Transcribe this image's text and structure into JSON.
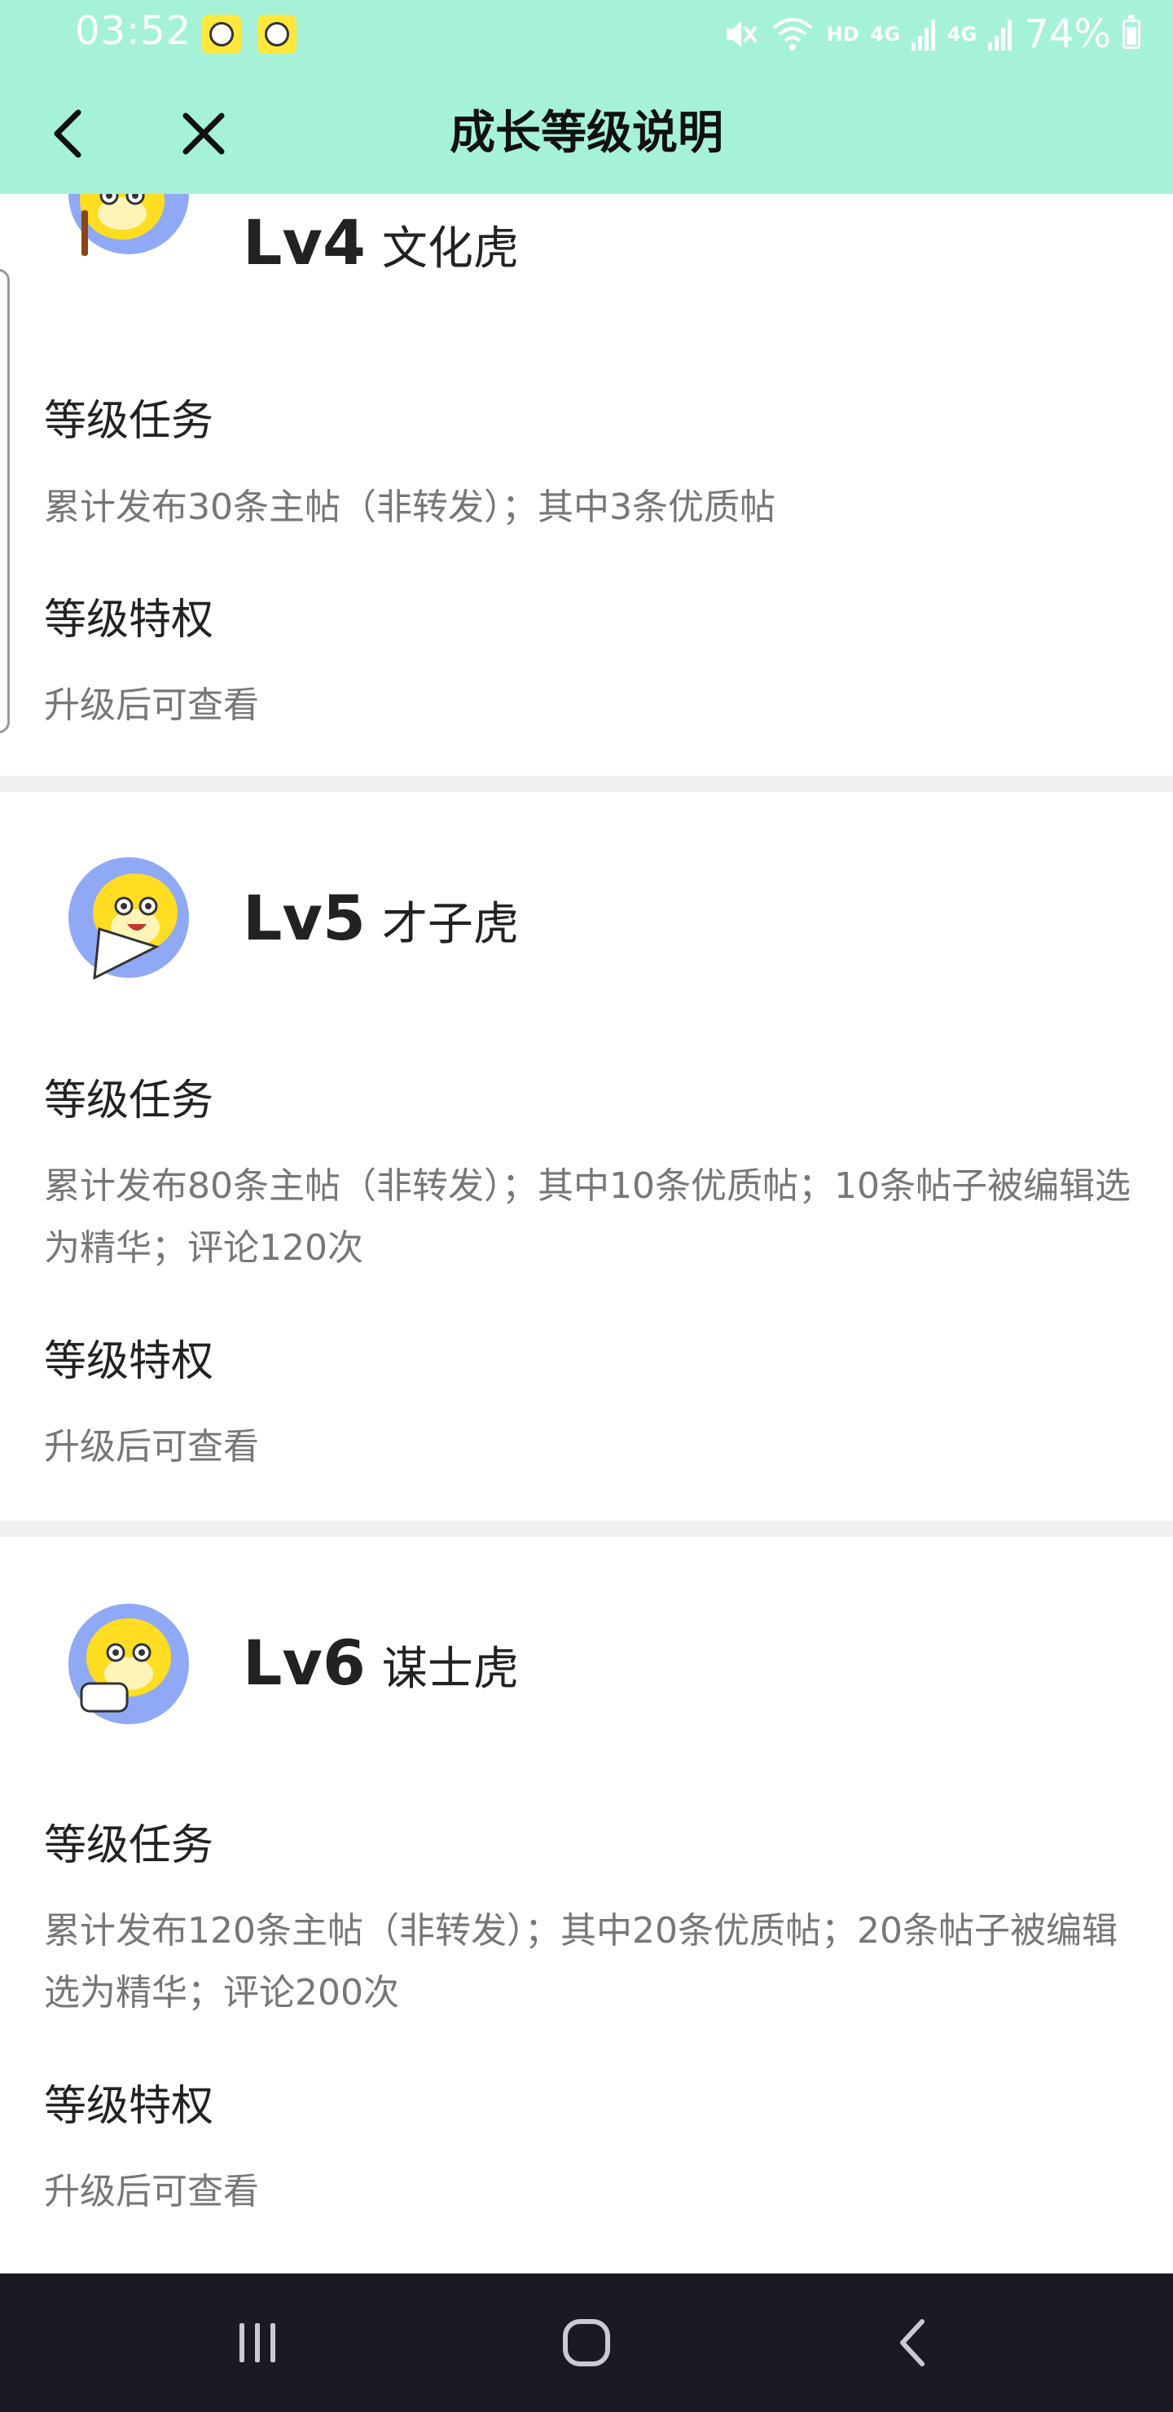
{
  "status_bar": {
    "time": "03:52",
    "network_hd": "HD",
    "network_4g_a": "4G",
    "network_4g_b": "4G",
    "battery": "74%",
    "battery_level": 0.74
  },
  "header": {
    "title": "成长等级说明"
  },
  "levels": [
    {
      "code": "Lv4",
      "name": "文化虎",
      "task_title": "等级任务",
      "task_text": "累计发布30条主帖（非转发）；其中3条优质帖",
      "privilege_title": "等级特权",
      "privilege_text": "升级后可查看"
    },
    {
      "code": "Lv5",
      "name": "才子虎",
      "task_title": "等级任务",
      "task_text": "累计发布80条主帖（非转发）；其中10条优质帖；10条帖子被编辑选为精华；评论120次",
      "privilege_title": "等级特权",
      "privilege_text": "升级后可查看"
    },
    {
      "code": "Lv6",
      "name": "谋士虎",
      "task_title": "等级任务",
      "task_text": "累计发布120条主帖（非转发）；其中20条优质帖；20条帖子被编辑选为精华；评论200次",
      "privilege_title": "等级特权",
      "privilege_text": "升级后可查看"
    }
  ],
  "colors": {
    "header_bg": "#A6F2D9",
    "avatar_bg": "#8FA9F7",
    "tiger_yellow": "#FFDD22",
    "navbar_bg": "#1A1B22"
  },
  "icons": {
    "back": "chevron-left-icon",
    "close": "close-icon",
    "nav_recent": "recent-apps-icon",
    "nav_home": "home-icon",
    "nav_back": "back-icon"
  }
}
